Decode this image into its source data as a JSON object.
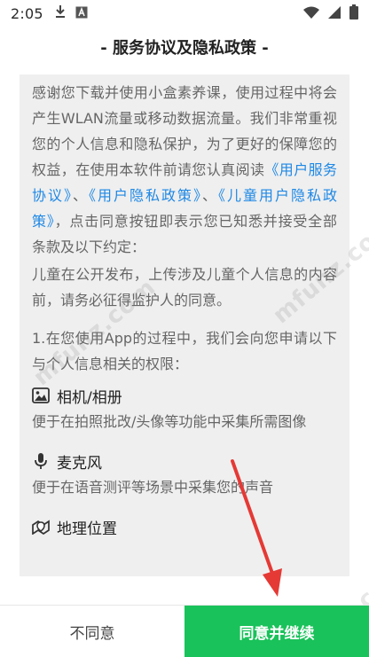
{
  "status_bar": {
    "time": "2:05",
    "icons": [
      "download-icon",
      "text-a-icon",
      "wifi-icon",
      "signal-icon",
      "battery-icon"
    ]
  },
  "dialog": {
    "title": "- 服务协议及隐私政策 -",
    "intro": {
      "t1": "感谢您下载并使用小盒素养课，使用过程中将会产生WLAN流量或移动数据流量。我们非常重视您的个人信息和隐私保护，为了更好的保障您的权益，在使用本软件前请您认真阅读",
      "link1": "《用户服务协议》",
      "sep1": "、",
      "link2": "《用户隐私政策》",
      "sep2": "、",
      "link3": "《儿童用户隐私政策》",
      "t2": "，点击同意按钮即表示您已知悉并接受全部条款及以下约定："
    },
    "child_note": "儿童在公开发布，上传涉及儿童个人信息的内容前，请务必征得监护人的同意。",
    "perm_intro": "1.在您使用App的过程中，我们会向您申请以下与个人信息相关的权限：",
    "permissions": [
      {
        "icon": "image-icon",
        "title": "相机/相册",
        "desc": "便于在拍照批改/头像等功能中采集所需图像"
      },
      {
        "icon": "microphone-icon",
        "title": "麦克风",
        "desc": "便于在语音测评等场景中采集您的声音"
      },
      {
        "icon": "location-icon",
        "title": "地理位置",
        "desc": ""
      }
    ]
  },
  "buttons": {
    "disagree": "不同意",
    "agree": "同意并继续"
  },
  "colors": {
    "accent_green": "#19c25a",
    "link_blue": "#1e88e5",
    "arrow_red": "#e53935"
  },
  "watermarks": [
    "mfunz.com",
    "mfunz.com",
    "mfunz.com"
  ]
}
